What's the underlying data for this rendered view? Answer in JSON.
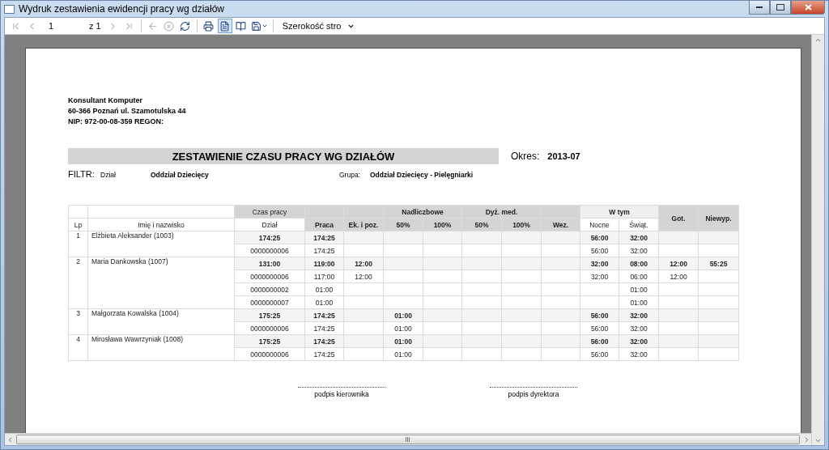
{
  "window": {
    "title": "Wydruk zestawienia ewidencji pracy wg działów"
  },
  "toolbar": {
    "buttons": [
      {
        "kind": "first",
        "disabled": true,
        "selected": false
      },
      {
        "kind": "prev",
        "disabled": true,
        "selected": false
      },
      {
        "kind": "page",
        "value": "1",
        "of": "z 1"
      },
      {
        "kind": "next",
        "disabled": true,
        "selected": false
      },
      {
        "kind": "last",
        "disabled": true,
        "selected": false
      },
      {
        "kind": "sep"
      },
      {
        "kind": "back",
        "disabled": true,
        "selected": false
      },
      {
        "kind": "stop",
        "disabled": true,
        "selected": false
      },
      {
        "kind": "refresh",
        "disabled": false,
        "selected": false
      },
      {
        "kind": "sep"
      },
      {
        "kind": "print",
        "disabled": false,
        "selected": false
      },
      {
        "kind": "layout",
        "disabled": false,
        "selected": true
      },
      {
        "kind": "setup",
        "disabled": false,
        "selected": false
      },
      {
        "kind": "export",
        "disabled": false,
        "selected": false
      },
      {
        "kind": "sep"
      },
      {
        "kind": "zoom",
        "value": "Szerokość stro"
      }
    ]
  },
  "report": {
    "company": [
      "Konsultant Komputer",
      "60-366 Poznań ul. Szamotulska 44",
      "NIP: 972-00-08-359 REGON:"
    ],
    "title": "ZESTAWIENIE CZASU PRACY WG DZIAŁÓW",
    "period_label": "Okres:",
    "period": "2013-07",
    "filter_label": "FILTR:",
    "department_label": "Dział",
    "department": "Oddział Dziecięcy",
    "group_label": "Grupa:",
    "group": "Oddział Dziecięcy - Pielęgniarki",
    "header_groups": {
      "czas_pracy": "Czas pracy",
      "nadliczbowe": "Nadliczbowe",
      "dyzury": "Dyż. med.",
      "w_tym": "W tym"
    },
    "columns": [
      "Lp",
      "Imię i nazwisko",
      "Dział",
      "Praca",
      "Ek. i poz.",
      "50%",
      "100%",
      "50%",
      "100%",
      "Wez.",
      "Nocne",
      "Świąt.",
      "Got.",
      "Niewyp."
    ],
    "employees": [
      {
        "lp": "1",
        "name": "Elżbieta Aleksander (1003)",
        "total": {
          "dzial": "174:25",
          "praca": "174:25",
          "nocne": "56:00",
          "swiat": "32:00"
        },
        "departments": [
          {
            "dzial": "0000000006",
            "praca": "174:25",
            "nocne": "56:00",
            "swiat": "32:00"
          }
        ]
      },
      {
        "lp": "2",
        "name": "Maria Dankowska (1007)",
        "total": {
          "dzial": "131:00",
          "praca": "119:00",
          "ek": "12:00",
          "nocne": "32:00",
          "swiat": "08:00",
          "got": "12:00",
          "niewyp": "55:25"
        },
        "departments": [
          {
            "dzial": "0000000006",
            "praca": "117:00",
            "ek": "12:00",
            "nocne": "32:00",
            "swiat": "06:00",
            "got": "12:00"
          },
          {
            "dzial": "0000000002",
            "praca": "01:00",
            "swiat": "01:00"
          },
          {
            "dzial": "0000000007",
            "praca": "01:00",
            "swiat": "01:00"
          }
        ]
      },
      {
        "lp": "3",
        "name": "Małgorzata Kowalska (1004)",
        "total": {
          "dzial": "175:25",
          "praca": "174:25",
          "n50": "01:00",
          "nocne": "56:00",
          "swiat": "32:00"
        },
        "departments": [
          {
            "dzial": "0000000006",
            "praca": "174:25",
            "n50": "01:00",
            "nocne": "56:00",
            "swiat": "32:00"
          }
        ]
      },
      {
        "lp": "4",
        "name": "Mirosława Wawrzyniak (1008)",
        "total": {
          "dzial": "175:25",
          "praca": "174:25",
          "n50": "01:00",
          "nocne": "56:00",
          "swiat": "32:00"
        },
        "departments": [
          {
            "dzial": "0000000006",
            "praca": "174:25",
            "n50": "01:00",
            "nocne": "56:00",
            "swiat": "32:00"
          }
        ]
      }
    ],
    "signatures": [
      "podpis kierownika",
      "podpis dyrektora"
    ]
  }
}
